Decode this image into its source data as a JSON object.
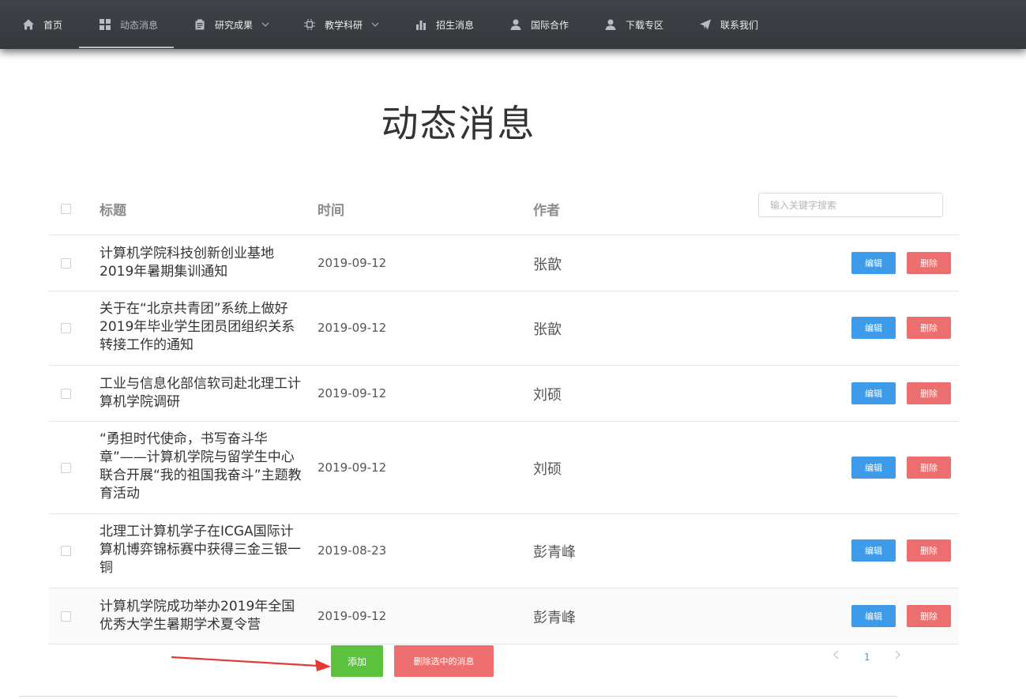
{
  "nav": {
    "items": [
      {
        "label": "首页",
        "icon": "home-icon"
      },
      {
        "label": "动态消息",
        "icon": "grid-icon"
      },
      {
        "label": "研究成果",
        "icon": "clipboard-icon"
      },
      {
        "label": "教学科研",
        "icon": "chip-icon"
      },
      {
        "label": "招生消息",
        "icon": "bar-chart-icon"
      },
      {
        "label": "国际合作",
        "icon": "user-icon"
      },
      {
        "label": "下载专区",
        "icon": "user-icon"
      },
      {
        "label": "联系我们",
        "icon": "send-icon"
      }
    ],
    "active": "动态消息"
  },
  "page": {
    "title": "动态消息"
  },
  "table": {
    "headers": {
      "title": "标题",
      "time": "时间",
      "author": "作者"
    },
    "search": {
      "placeholder": "输入关键字搜索",
      "value": ""
    },
    "edit_label": "编辑",
    "delete_label": "删除",
    "rows": [
      {
        "title": "计算机学院科技创新创业基地2019年暑期集训通知",
        "time": "2019-09-12",
        "author": "张歆"
      },
      {
        "title": "关于在“北京共青团”系统上做好2019年毕业学生团员团组织关系转接工作的通知",
        "time": "2019-09-12",
        "author": "张歆"
      },
      {
        "title": "工业与信息化部信软司赴北理工计算机学院调研",
        "time": "2019-09-12",
        "author": "刘硕"
      },
      {
        "title": "“勇担时代使命，书写奋斗华章”——计算机学院与留学生中心联合开展“我的祖国我奋斗”主题教育活动",
        "time": "2019-09-12",
        "author": "刘硕"
      },
      {
        "title": "北理工计算机学子在ICGA国际计算机博弈锦标赛中获得三金三银一铜",
        "time": "2019-08-23",
        "author": "彭青峰"
      },
      {
        "title": "计算机学院成功举办2019年全国优秀大学生暑期学术夏令营",
        "time": "2019-09-12",
        "author": "彭青峰"
      }
    ]
  },
  "actions": {
    "add_label": "添加",
    "delete_selected_label": "删除选中的消息"
  },
  "pagination": {
    "current": "1"
  },
  "colors": {
    "nav_bg": "#3a3d41",
    "edit": "#3d9be9",
    "delete": "#ed6e6e",
    "add": "#5cc23d",
    "annotation_arrow": "#e53935"
  }
}
